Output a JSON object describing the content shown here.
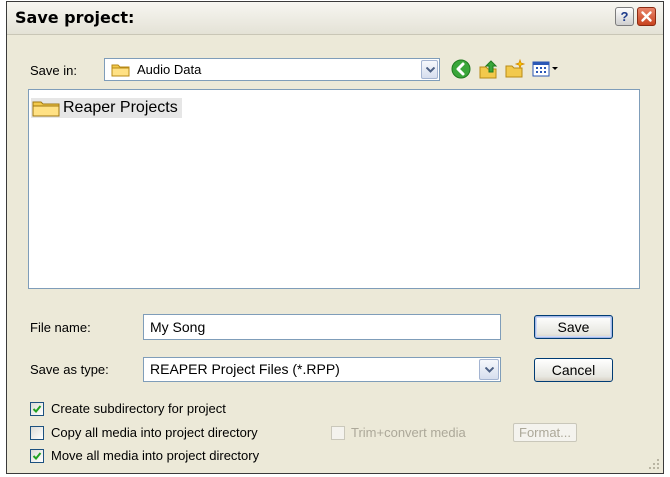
{
  "dialog": {
    "title": "Save project:",
    "help_icon": "question-mark-icon",
    "close_icon": "close-x-icon"
  },
  "save_in": {
    "label": "Save in:",
    "value": "Audio Data",
    "folder_icon": "folder-icon",
    "toolbar_icons": [
      "back-icon",
      "up-one-level-icon",
      "create-new-folder-icon",
      "view-menu-icon"
    ]
  },
  "file_list": {
    "items": [
      {
        "name": "Reaper Projects",
        "icon": "folder-icon"
      }
    ]
  },
  "file_name": {
    "label": "File name:",
    "value": "My Song"
  },
  "save_as_type": {
    "label": "Save as type:",
    "value": "REAPER Project Files (*.RPP)"
  },
  "buttons": {
    "save": "Save",
    "cancel": "Cancel",
    "format": "Format..."
  },
  "options": {
    "create_subdirectory": {
      "label": "Create subdirectory for project",
      "checked": true
    },
    "copy_media": {
      "label": "Copy all media into project directory",
      "checked": false
    },
    "trim_convert": {
      "label": "Trim+convert media",
      "checked": false,
      "enabled": false
    },
    "move_media": {
      "label": "Move all media into project directory",
      "checked": true
    }
  },
  "colors": {
    "dialog_bg": "#ece9d8",
    "field_border": "#7f9db9",
    "button_border": "#003c74",
    "close_button": "#c8431f",
    "check_mark": "#21a121"
  }
}
